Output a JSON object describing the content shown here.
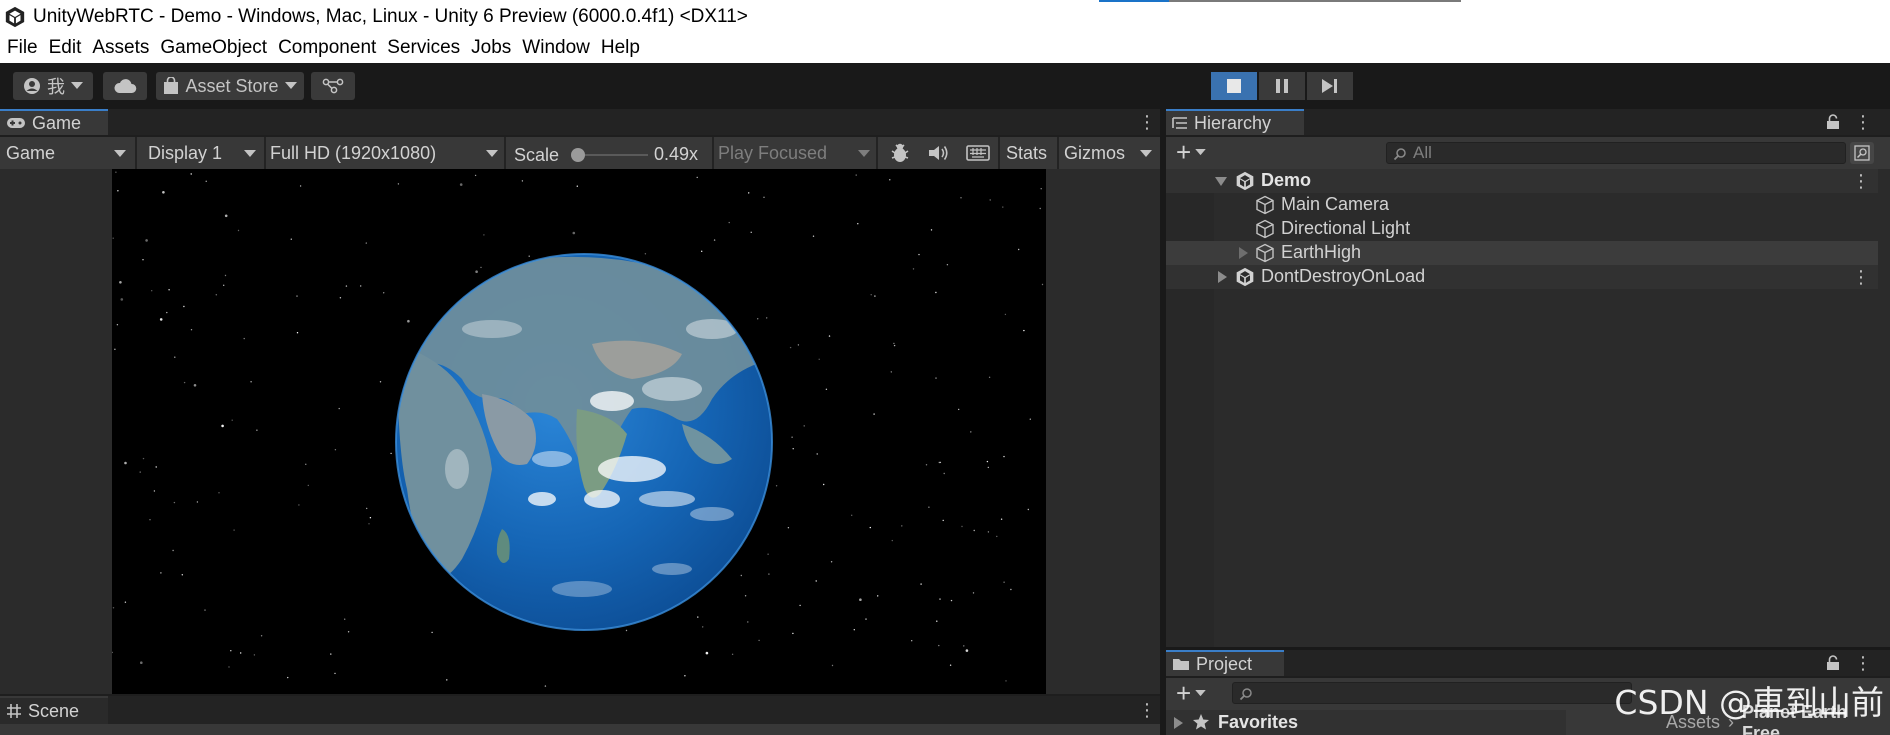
{
  "window": {
    "title": "UnityWebRTC - Demo - Windows, Mac, Linux - Unity 6 Preview (6000.0.4f1) <DX11>"
  },
  "menu": [
    "File",
    "Edit",
    "Assets",
    "GameObject",
    "Component",
    "Services",
    "Jobs",
    "Window",
    "Help"
  ],
  "toolbar": {
    "account_label": "我",
    "asset_store_label": "Asset Store",
    "play_mode_active": true
  },
  "game_panel": {
    "tab_label": "Game",
    "view_mode": "Game",
    "display": "Display 1",
    "resolution": "Full HD (1920x1080)",
    "scale_label": "Scale",
    "scale_value": "0.49x",
    "play_mode_option": "Play Focused",
    "stats_label": "Stats",
    "gizmos_label": "Gizmos"
  },
  "scene_panel": {
    "tab_label": "Scene"
  },
  "hierarchy": {
    "tab_label": "Hierarchy",
    "search_placeholder": "All",
    "rows": [
      {
        "label": "Demo",
        "type": "scene",
        "expanded": true
      },
      {
        "label": "Main Camera",
        "type": "object"
      },
      {
        "label": "Directional Light",
        "type": "object"
      },
      {
        "label": "EarthHigh",
        "type": "object",
        "has_children": true
      },
      {
        "label": "DontDestroyOnLoad",
        "type": "scene",
        "expanded": false
      }
    ]
  },
  "project": {
    "tab_label": "Project",
    "favorites_label": "Favorites",
    "breadcrumb": [
      "Assets",
      "Planet Earth Free"
    ]
  },
  "watermark": "CSDN @車到山前",
  "colors": {
    "accent_blue": "#3a7ec8",
    "play_active": "#3a72b0",
    "panel_bg": "#383838",
    "earth_ocean": "#1565b5"
  }
}
